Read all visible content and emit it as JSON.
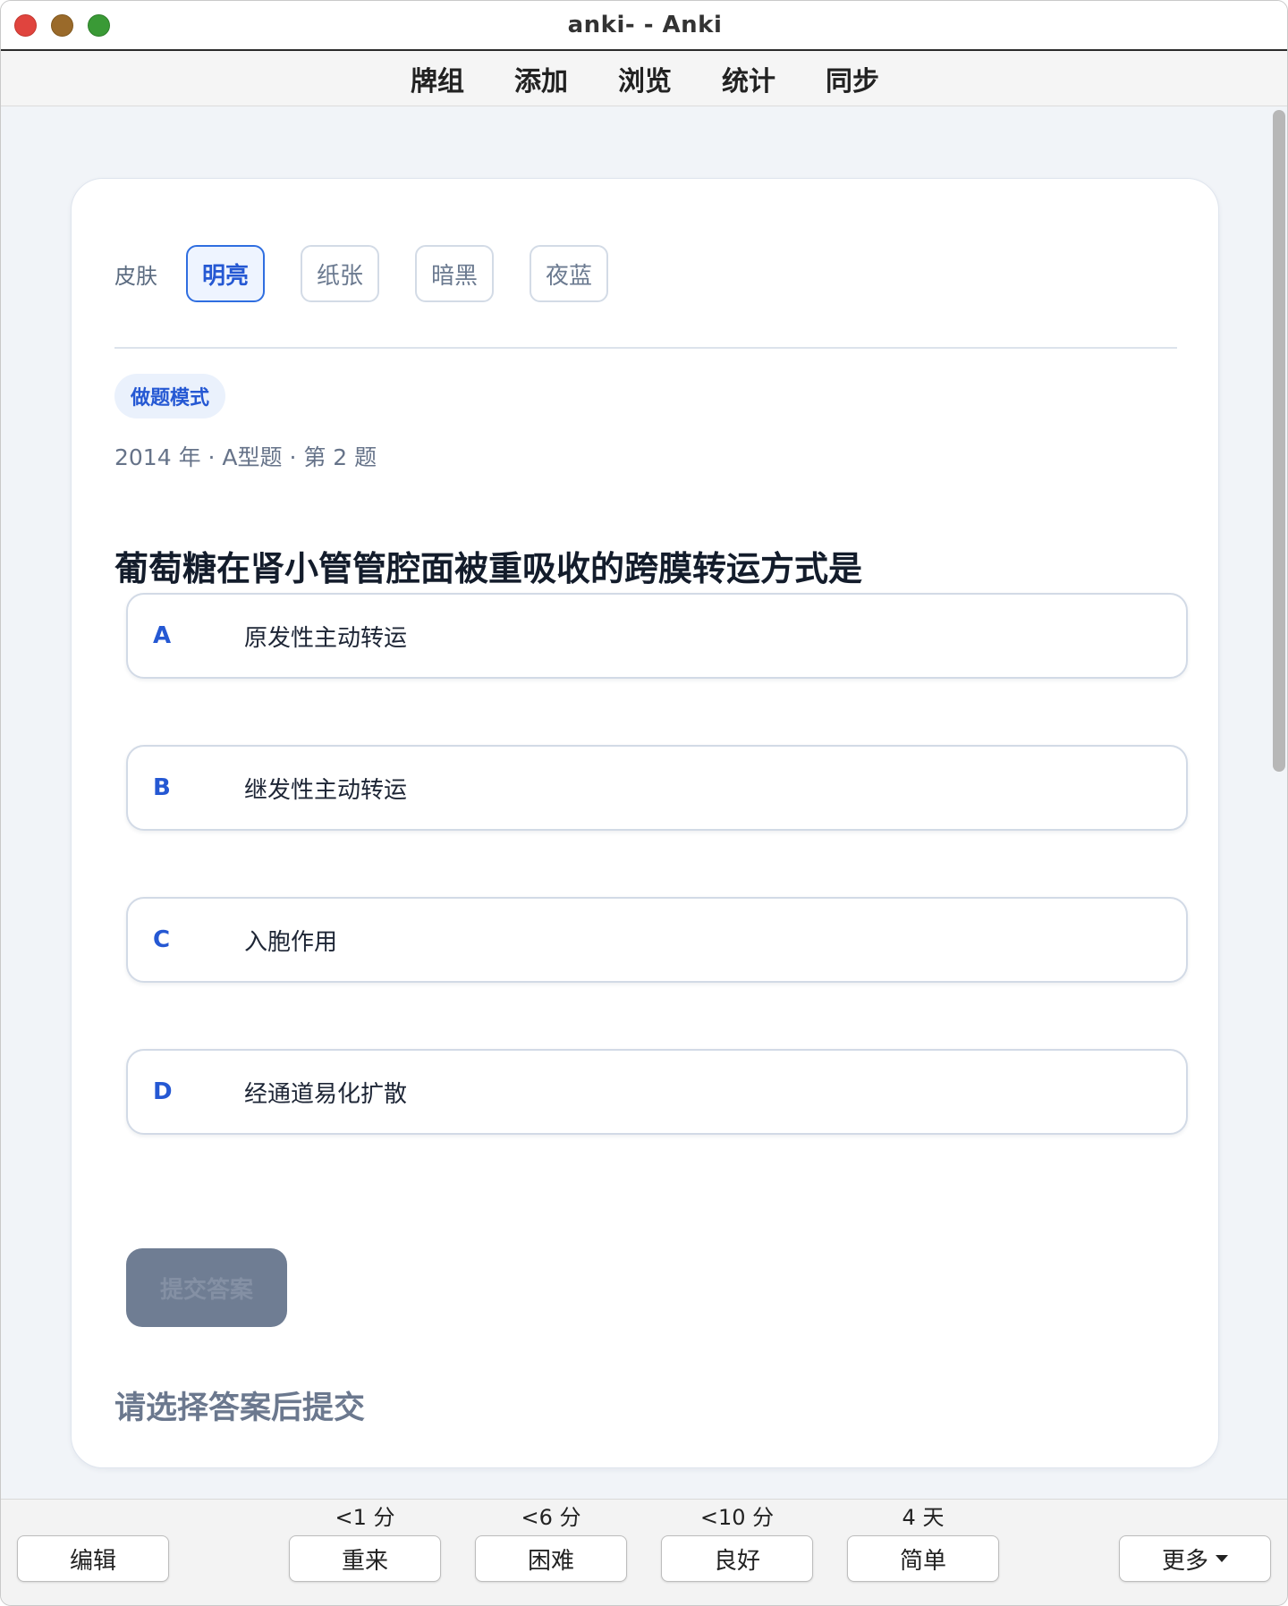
{
  "window": {
    "title": "anki- - Anki"
  },
  "toolbar": {
    "items": [
      "牌组",
      "添加",
      "浏览",
      "统计",
      "同步"
    ]
  },
  "card": {
    "skin_label": "皮肤",
    "skins": [
      {
        "label": "明亮",
        "active": true
      },
      {
        "label": "纸张",
        "active": false
      },
      {
        "label": "暗黑",
        "active": false
      },
      {
        "label": "夜蓝",
        "active": false
      }
    ],
    "mode_badge": "做题模式",
    "meta": "2014 年 · A型题 · 第 2 题",
    "question": "葡萄糖在肾小管管腔面被重吸收的跨膜转运方式是",
    "options": [
      {
        "letter": "A",
        "text": "原发性主动转运"
      },
      {
        "letter": "B",
        "text": "继发性主动转运"
      },
      {
        "letter": "C",
        "text": "入胞作用"
      },
      {
        "letter": "D",
        "text": "经通道易化扩散"
      }
    ],
    "submit_label": "提交答案",
    "hint": "请选择答案后提交"
  },
  "bottom": {
    "edit": "编辑",
    "answers": [
      {
        "interval": "<1 分",
        "label": "重来"
      },
      {
        "interval": "<6 分",
        "label": "困难"
      },
      {
        "interval": "<10 分",
        "label": "良好"
      },
      {
        "interval": "4 天",
        "label": "简单"
      }
    ],
    "more": "更多"
  },
  "colors": {
    "accent": "#2558d3",
    "submit_disabled": "#6f7d93"
  }
}
